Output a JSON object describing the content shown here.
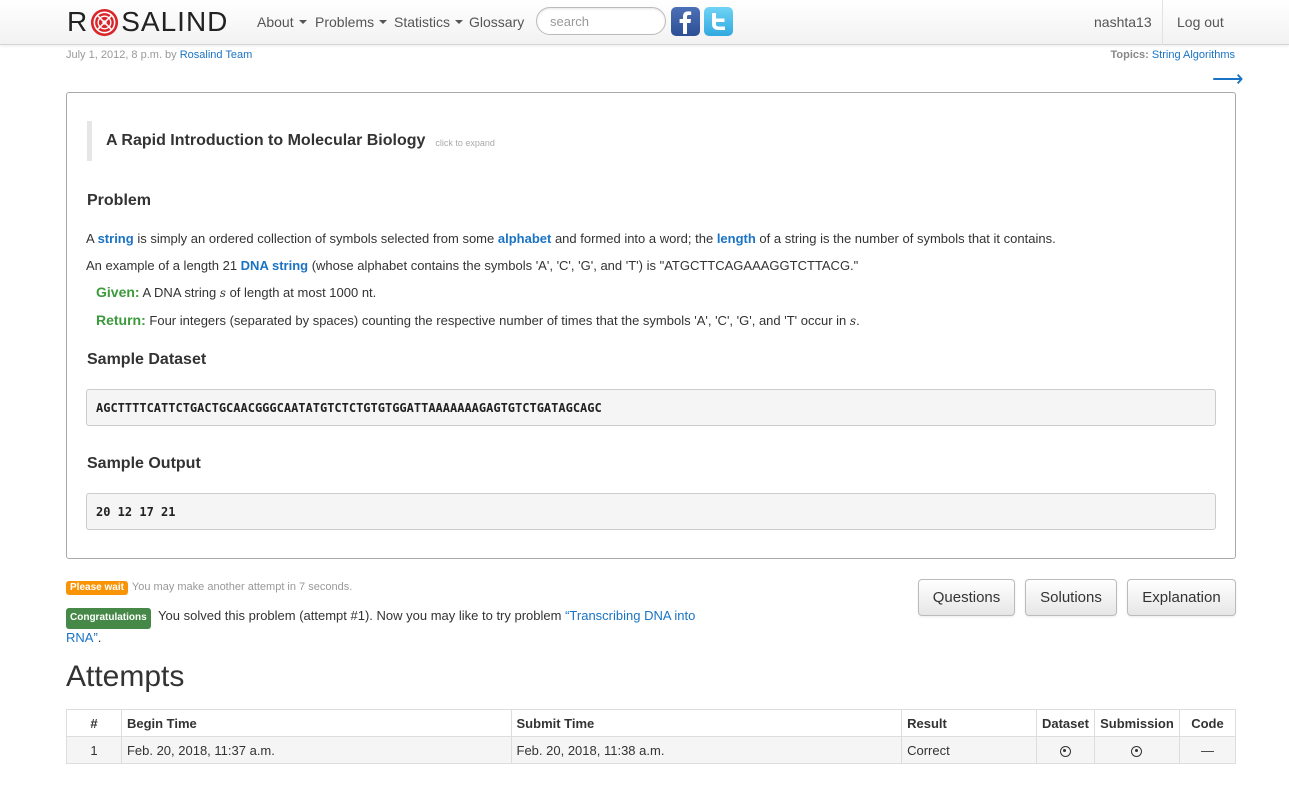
{
  "navbar": {
    "brand_prefix": "R",
    "brand_suffix": "SALIND",
    "menu": [
      {
        "label": "About",
        "has_caret": true
      },
      {
        "label": "Problems",
        "has_caret": true
      },
      {
        "label": "Statistics",
        "has_caret": true
      },
      {
        "label": "Glossary",
        "has_caret": false
      }
    ],
    "search_placeholder": "search",
    "social": [
      "facebook-icon",
      "twitter-icon"
    ],
    "username": "nashta13",
    "logout_label": "Log out"
  },
  "meta": {
    "date_text": "July 1, 2012, 8 p.m. by ",
    "author": "Rosalind Team",
    "topics_label": "Topics:",
    "topics_value": "String Algorithms",
    "next_arrow": "⟶"
  },
  "problem": {
    "intro_title": "A Rapid Introduction to Molecular Biology",
    "intro_hint": "click to expand",
    "problem_heading": "Problem",
    "p1": {
      "t1": "A ",
      "k1": "string",
      "t2": " is simply an ordered collection of symbols selected from some ",
      "k2": "alphabet",
      "t3": " and formed into a word; the ",
      "k3": "length",
      "t4": " of a string is the number of symbols that it contains."
    },
    "p2": {
      "t1": "An example of a length 21 ",
      "k1": "DNA string",
      "t2": " (whose alphabet contains the symbols 'A', 'C', 'G', and 'T') is \"ATGCTTCAGAAAGGTCTTACG.\""
    },
    "given": {
      "label": "Given:",
      "t1": " A DNA string ",
      "var": "s",
      "t2": " of length at most 1000 nt."
    },
    "return": {
      "label": "Return:",
      "t1": " Four integers (separated by spaces) counting the respective number of times that the symbols 'A', 'C', 'G', and 'T' occur in ",
      "var": "s",
      "t2": "."
    },
    "sample_dataset_heading": "Sample Dataset",
    "sample_dataset": "AGCTTTTCATTCTGACTGCAACGGGCAATATGTCTCTGTGTGGATTAAAAAAAGAGTGTCTGATAGCAGC",
    "sample_output_heading": "Sample Output",
    "sample_output": "20 12 17 21"
  },
  "status": {
    "wait_badge": "Please wait",
    "wait_text": "You may make another attempt in 7 seconds.",
    "ok_badge": "Congratulations",
    "ok_text": " You solved this problem (attempt #1). Now you may like to try problem ",
    "next_problem_link": "“Transcribing DNA into RNA”",
    "ok_tail": "."
  },
  "buttons": {
    "questions": "Questions",
    "solutions": "Solutions",
    "explanation": "Explanation"
  },
  "attempts": {
    "heading": "Attempts",
    "columns": [
      "#",
      "Begin Time",
      "Submit Time",
      "Result",
      "Dataset",
      "Submission",
      "Code"
    ],
    "rows": [
      {
        "num": "1",
        "begin": "Feb. 20, 2018, 11:37 a.m.",
        "submit": "Feb. 20, 2018, 11:38 a.m.",
        "result": "Correct",
        "dataset": "download-icon",
        "submission": "download-icon",
        "code": "—"
      }
    ]
  }
}
